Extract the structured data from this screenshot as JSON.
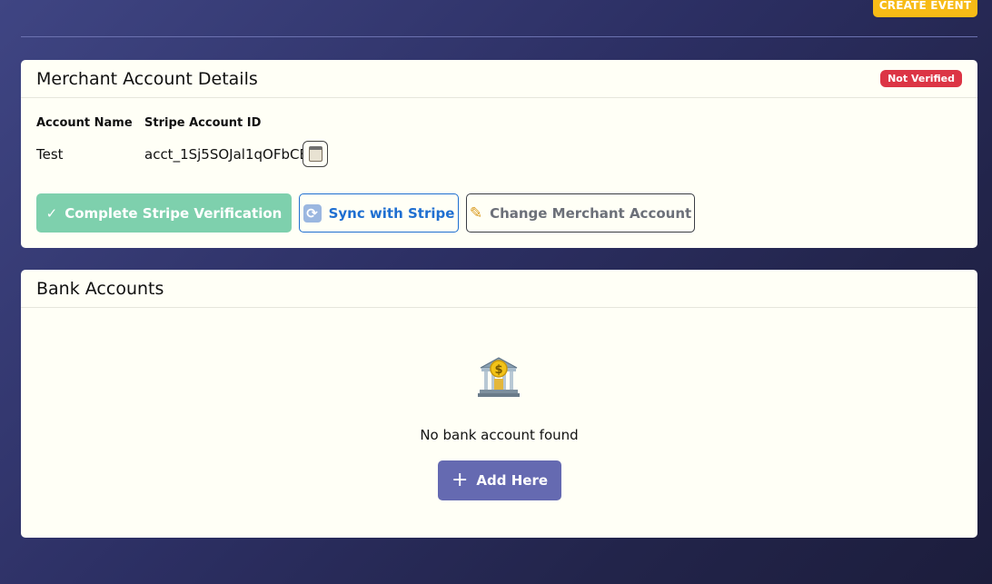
{
  "header": {
    "create_event_label": "CREATE EVENT"
  },
  "merchant": {
    "title": "Merchant Account Details",
    "status_badge": "Not Verified",
    "account_name_label": "Account Name",
    "stripe_id_label": "Stripe Account ID",
    "account_name": "Test",
    "stripe_account_id": "acct_1Sj5SOJal1qOFbCE",
    "copy_icon": "clipboard-icon",
    "verify_icon": "✓",
    "verify_label": "Complete Stripe Verification",
    "sync_icon": "🔄",
    "sync_label": "Sync with Stripe",
    "change_icon": "✏️",
    "change_label": "Change Merchant Account"
  },
  "bank": {
    "title": "Bank Accounts",
    "empty_icon": "bank-icon",
    "empty_text": "No bank account found",
    "add_icon": "+",
    "add_label": "Add Here"
  },
  "colors": {
    "badge": "#dc3545",
    "verify_button": "#7ed0ad",
    "sync_button": "#1f6fd1",
    "add_button": "#656ab1",
    "create_event": "#f7bb16"
  }
}
